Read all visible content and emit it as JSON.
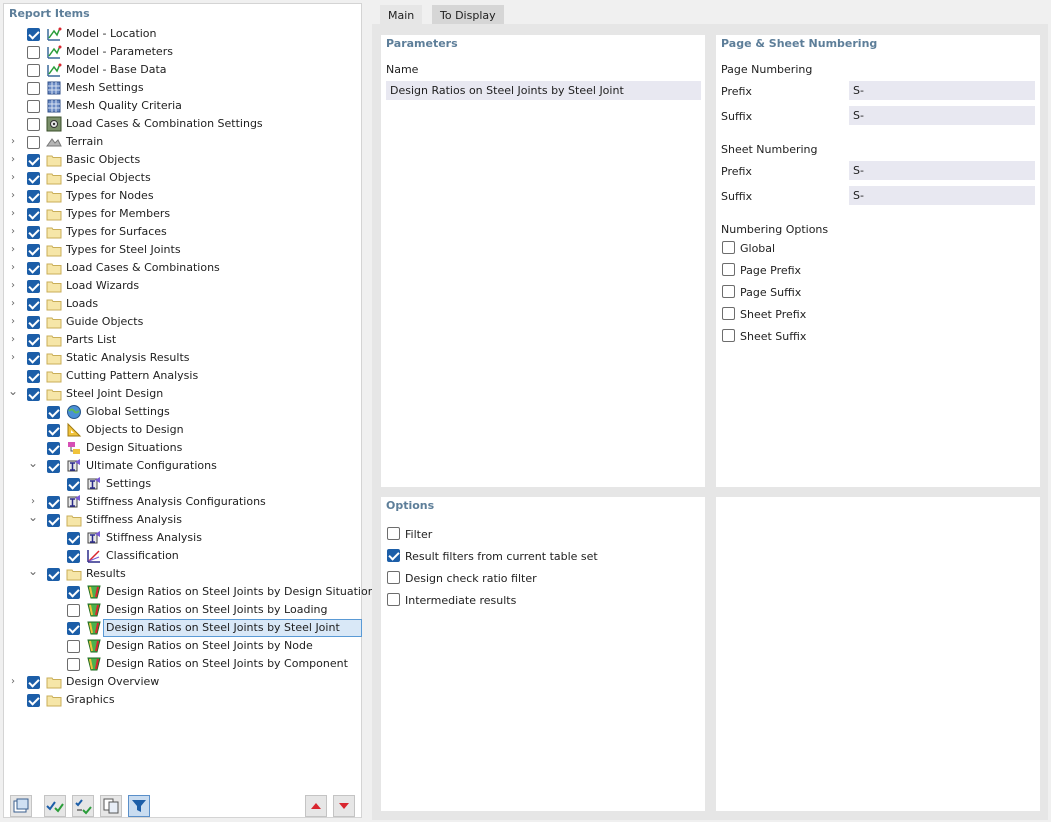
{
  "left_panel": {
    "title": "Report Items",
    "items": [
      {
        "label": "Model - Location",
        "checked": true,
        "icon": "model-icon",
        "level": 0,
        "expander": "none"
      },
      {
        "label": "Model - Parameters",
        "checked": false,
        "icon": "model-icon",
        "level": 0,
        "expander": "none"
      },
      {
        "label": "Model - Base Data",
        "checked": false,
        "icon": "model-icon",
        "level": 0,
        "expander": "none"
      },
      {
        "label": "Mesh Settings",
        "checked": false,
        "icon": "mesh-icon",
        "level": 0,
        "expander": "none"
      },
      {
        "label": "Mesh Quality Criteria",
        "checked": false,
        "icon": "mesh-icon",
        "level": 0,
        "expander": "none"
      },
      {
        "label": "Load Cases & Combination Settings",
        "checked": false,
        "icon": "settings-icon",
        "level": 0,
        "expander": "none"
      },
      {
        "label": "Terrain",
        "checked": false,
        "icon": "terrain-icon",
        "level": 0,
        "expander": "collapsed"
      },
      {
        "label": "Basic Objects",
        "checked": true,
        "icon": "folder-icon",
        "level": 0,
        "expander": "collapsed"
      },
      {
        "label": "Special Objects",
        "checked": true,
        "icon": "folder-icon",
        "level": 0,
        "expander": "collapsed"
      },
      {
        "label": "Types for Nodes",
        "checked": true,
        "icon": "folder-icon",
        "level": 0,
        "expander": "collapsed"
      },
      {
        "label": "Types for Members",
        "checked": true,
        "icon": "folder-icon",
        "level": 0,
        "expander": "collapsed"
      },
      {
        "label": "Types for Surfaces",
        "checked": true,
        "icon": "folder-icon",
        "level": 0,
        "expander": "collapsed"
      },
      {
        "label": "Types for Steel Joints",
        "checked": true,
        "icon": "folder-icon",
        "level": 0,
        "expander": "collapsed"
      },
      {
        "label": "Load Cases & Combinations",
        "checked": true,
        "icon": "folder-icon",
        "level": 0,
        "expander": "collapsed"
      },
      {
        "label": "Load Wizards",
        "checked": true,
        "icon": "folder-icon",
        "level": 0,
        "expander": "collapsed"
      },
      {
        "label": "Loads",
        "checked": true,
        "icon": "folder-icon",
        "level": 0,
        "expander": "collapsed"
      },
      {
        "label": "Guide Objects",
        "checked": true,
        "icon": "folder-icon",
        "level": 0,
        "expander": "collapsed"
      },
      {
        "label": "Parts List",
        "checked": true,
        "icon": "folder-icon",
        "level": 0,
        "expander": "collapsed"
      },
      {
        "label": "Static Analysis Results",
        "checked": true,
        "icon": "folder-icon",
        "level": 0,
        "expander": "collapsed"
      },
      {
        "label": "Cutting Pattern Analysis",
        "checked": true,
        "icon": "folder-icon",
        "level": 0,
        "expander": "none"
      },
      {
        "label": "Steel Joint Design",
        "checked": true,
        "icon": "folder-icon",
        "level": 0,
        "expander": "expanded"
      },
      {
        "label": "Global Settings",
        "checked": true,
        "icon": "globe-icon",
        "level": 1,
        "expander": "none"
      },
      {
        "label": "Objects to Design",
        "checked": true,
        "icon": "triangle-ruler-icon",
        "level": 1,
        "expander": "none"
      },
      {
        "label": "Design Situations",
        "checked": true,
        "icon": "design-situations-icon",
        "level": 1,
        "expander": "none"
      },
      {
        "label": "Ultimate Configurations",
        "checked": true,
        "icon": "configuration-icon",
        "level": 1,
        "expander": "expanded"
      },
      {
        "label": "Settings",
        "checked": true,
        "icon": "configuration-icon",
        "level": 2,
        "expander": "none"
      },
      {
        "label": "Stiffness Analysis Configurations",
        "checked": true,
        "icon": "configuration-icon",
        "level": 1,
        "expander": "collapsed"
      },
      {
        "label": "Stiffness Analysis",
        "checked": true,
        "icon": "folder-icon",
        "level": 1,
        "expander": "expanded"
      },
      {
        "label": "Stiffness Analysis",
        "checked": true,
        "icon": "configuration-icon",
        "level": 2,
        "expander": "none"
      },
      {
        "label": "Classification",
        "checked": true,
        "icon": "classification-icon",
        "level": 2,
        "expander": "none"
      },
      {
        "label": "Results",
        "checked": true,
        "icon": "folder-icon",
        "level": 1,
        "expander": "expanded"
      },
      {
        "label": "Design Ratios on Steel Joints by Design Situation",
        "checked": true,
        "icon": "design-ratio-icon",
        "level": 2,
        "expander": "none"
      },
      {
        "label": "Design Ratios on Steel Joints by Loading",
        "checked": false,
        "icon": "design-ratio-icon",
        "level": 2,
        "expander": "none"
      },
      {
        "label": "Design Ratios on Steel Joints by Steel Joint",
        "checked": true,
        "icon": "design-ratio-icon",
        "level": 2,
        "expander": "none",
        "selected": true
      },
      {
        "label": "Design Ratios on Steel Joints by Node",
        "checked": false,
        "icon": "design-ratio-icon",
        "level": 2,
        "expander": "none"
      },
      {
        "label": "Design Ratios on Steel Joints by Component",
        "checked": false,
        "icon": "design-ratio-icon",
        "level": 2,
        "expander": "none"
      },
      {
        "label": "Design Overview",
        "checked": true,
        "icon": "folder-icon",
        "level": 0,
        "expander": "collapsed"
      },
      {
        "label": "Graphics",
        "checked": true,
        "icon": "folder-icon",
        "level": 0,
        "expander": "none"
      }
    ],
    "toolbar": [
      {
        "name": "new-window-icon",
        "active": false
      },
      {
        "name": "check-all-icon",
        "active": false
      },
      {
        "name": "toggle-check-icon",
        "active": false
      },
      {
        "name": "copy-icon",
        "active": false
      },
      {
        "name": "filter-icon",
        "active": true
      },
      {
        "name": "move-up-icon",
        "active": false
      },
      {
        "name": "move-down-icon",
        "active": false
      }
    ]
  },
  "tabs": [
    {
      "label": "Main",
      "active": true
    },
    {
      "label": "To Display",
      "active": false
    }
  ],
  "parameters": {
    "title": "Parameters",
    "name_label": "Name",
    "name_value": "Design Ratios on Steel Joints by Steel Joint"
  },
  "numbering": {
    "title": "Page & Sheet Numbering",
    "page_heading": "Page Numbering",
    "page_prefix_label": "Prefix",
    "page_prefix_value": "S-",
    "page_suffix_label": "Suffix",
    "page_suffix_value": "S-",
    "sheet_heading": "Sheet Numbering",
    "sheet_prefix_label": "Prefix",
    "sheet_prefix_value": "S-",
    "sheet_suffix_label": "Suffix",
    "sheet_suffix_value": "S-",
    "options_heading": "Numbering Options",
    "options": [
      {
        "label": "Global",
        "checked": false
      },
      {
        "label": "Page Prefix",
        "checked": false
      },
      {
        "label": "Page Suffix",
        "checked": false
      },
      {
        "label": "Sheet Prefix",
        "checked": false
      },
      {
        "label": "Sheet Suffix",
        "checked": false
      }
    ]
  },
  "options": {
    "title": "Options",
    "items": [
      {
        "label": "Filter",
        "checked": false
      },
      {
        "label": "Result filters from current table set",
        "checked": true
      },
      {
        "label": "Design check ratio filter",
        "checked": false
      },
      {
        "label": "Intermediate results",
        "checked": false
      }
    ]
  },
  "colors": {
    "accent": "#1c5ea8",
    "section_title": "#5d7e99",
    "selection_bg": "#d9e8f7",
    "selection_border": "#5a9ad5",
    "input_bg": "#e8e8f1"
  }
}
